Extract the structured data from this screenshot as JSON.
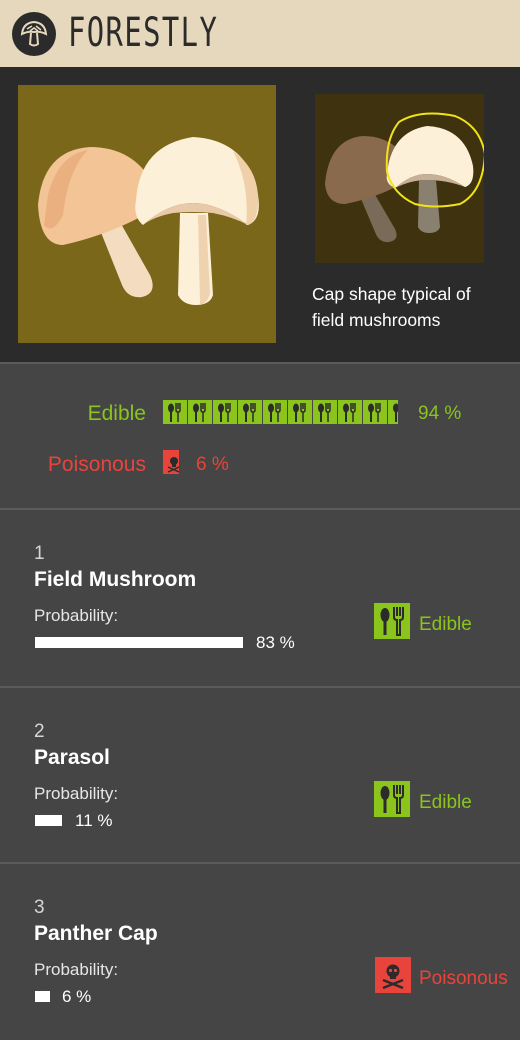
{
  "header": {
    "title": "FORESTLY",
    "logo_icon": "mushroom-logo-icon"
  },
  "photo": {
    "caption": "Cap shape typical of field mushrooms"
  },
  "verdict": {
    "edible": {
      "label": "Edible",
      "percent_text": "94 %",
      "value": 0.94,
      "color": "#8ac41c",
      "icon": "cutlery-icon"
    },
    "poisonous": {
      "label": "Poisonous",
      "percent_text": "6 %",
      "value": 0.06,
      "color": "#e8443c",
      "icon": "skull-icon"
    }
  },
  "results": [
    {
      "rank": "1",
      "name": "Field Mushroom",
      "probability_label": "Probability:",
      "probability": 0.83,
      "probability_text": "83 %",
      "status": "Edible",
      "status_icon": "cutlery-icon"
    },
    {
      "rank": "2",
      "name": "Parasol",
      "probability_label": "Probability:",
      "probability": 0.11,
      "probability_text": "11 %",
      "status": "Edible",
      "status_icon": "cutlery-icon"
    },
    {
      "rank": "3",
      "name": "Panther Cap",
      "probability_label": "Probability:",
      "probability": 0.06,
      "probability_text": "6 %",
      "status": "Poisonous",
      "status_icon": "skull-icon"
    }
  ]
}
